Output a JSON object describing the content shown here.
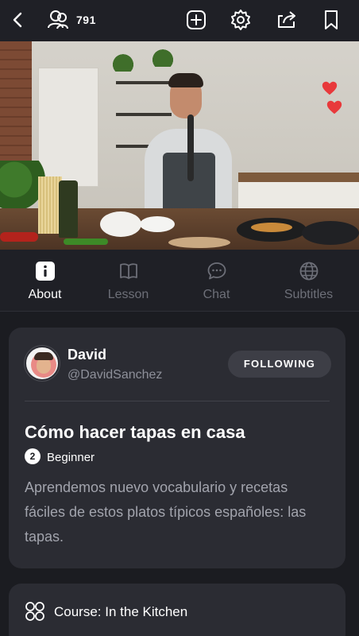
{
  "header": {
    "viewer_count": "791",
    "icons": [
      "back-icon",
      "viewers-icon",
      "add-icon",
      "gear-icon",
      "share-icon",
      "bookmark-icon"
    ]
  },
  "tabs": [
    {
      "label": "About",
      "icon": "info-icon",
      "active": true
    },
    {
      "label": "Lesson",
      "icon": "book-icon",
      "active": false
    },
    {
      "label": "Chat",
      "icon": "chat-icon",
      "active": false
    },
    {
      "label": "Subtitles",
      "icon": "globe-icon",
      "active": false
    }
  ],
  "author": {
    "name": "David",
    "handle": "@DavidSanchez",
    "follow_label": "FOLLOWING"
  },
  "lesson": {
    "title": "Cómo hacer tapas en casa",
    "level_number": "2",
    "level_label": "Beginner",
    "description": "Aprendemos nuevo vocabulario y recetas fáciles de estos platos típicos españoles: las tapas."
  },
  "course": {
    "label": "Course: In the Kitchen",
    "icon": "course-grid-icon"
  },
  "colors": {
    "background": "#1b1c21",
    "card": "#2b2c33",
    "muted_text": "#a2a4ad",
    "inactive_tab": "#6d6f78",
    "heart": "#e8393b"
  }
}
